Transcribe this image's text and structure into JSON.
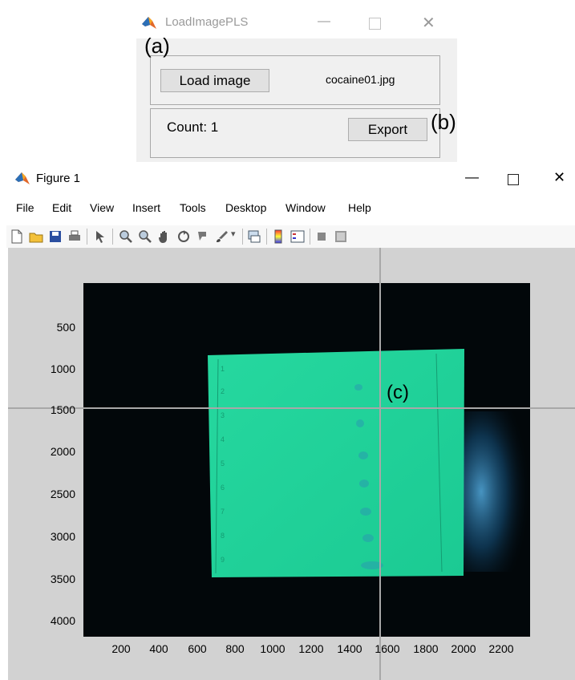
{
  "loader": {
    "title": "LoadImagePLS",
    "load_label": "Load image",
    "filename": "cocaine01.jpg",
    "count_text": "Count: 1",
    "export_label": "Export"
  },
  "annotations": {
    "a": "(a)",
    "b": "(b)",
    "c": "(c)"
  },
  "figure": {
    "title": "Figure 1",
    "menu": [
      "File",
      "Edit",
      "View",
      "Insert",
      "Tools",
      "Desktop",
      "Window",
      "Help"
    ],
    "y_ticks": [
      "500",
      "1000",
      "1500",
      "2000",
      "2500",
      "3000",
      "3500",
      "4000"
    ],
    "x_ticks": [
      "200",
      "400",
      "600",
      "800",
      "1000",
      "1200",
      "1400",
      "1600",
      "1800",
      "2000",
      "2200"
    ],
    "crosshair": {
      "x": 1600,
      "y": 1500
    }
  },
  "plate_marks": [
    "1",
    "2",
    "3",
    "4",
    "5",
    "6",
    "7",
    "8",
    "9"
  ],
  "colors": {
    "plate": "#1fd49a",
    "background": "#02070a",
    "axes_bg": "#d2d2d2"
  }
}
